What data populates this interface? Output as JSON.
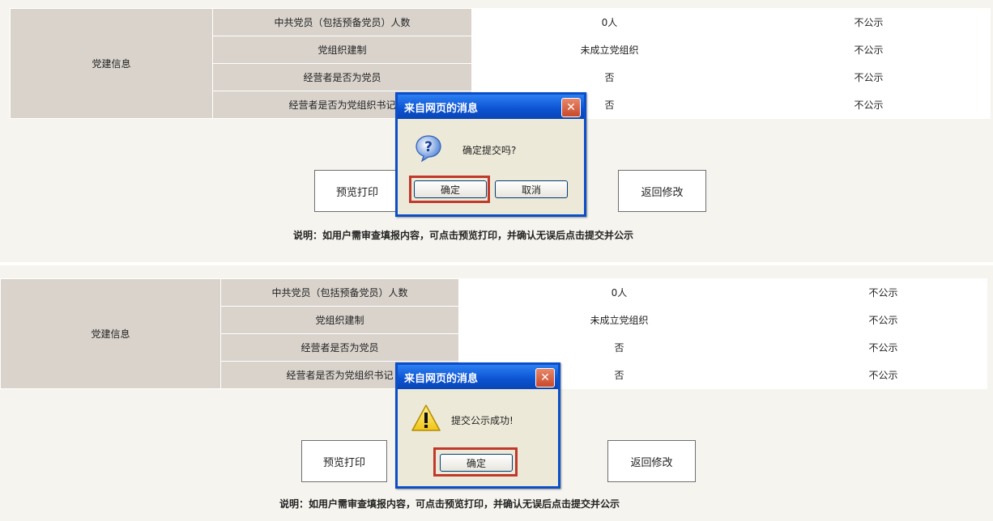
{
  "panel1": {
    "group_label": "党建信息",
    "rows": [
      {
        "label": "中共党员（包括预备党员）人数",
        "value": "0人",
        "public": "不公示"
      },
      {
        "label": "党组织建制",
        "value": "未成立党组织",
        "public": "不公示"
      },
      {
        "label": "经营者是否为党员",
        "value": "否",
        "public": "不公示"
      },
      {
        "label": "经营者是否为党组织书记",
        "value": "否",
        "public": "不公示"
      }
    ],
    "preview_label": "预览打印",
    "back_label": "返回修改",
    "note": "说明：如用户需审查填报内容，可点击预览打印，并确认无误后点击提交并公示",
    "dialog": {
      "title": "来自网页的消息",
      "icon": "question-icon",
      "message": "确定提交吗?",
      "ok_label": "确定",
      "cancel_label": "取消",
      "close_glyph": "✕"
    }
  },
  "panel2": {
    "group_label": "党建信息",
    "rows": [
      {
        "label": "中共党员（包括预备党员）人数",
        "value": "0人",
        "public": "不公示"
      },
      {
        "label": "党组织建制",
        "value": "未成立党组织",
        "public": "不公示"
      },
      {
        "label": "经营者是否为党员",
        "value": "否",
        "public": "不公示"
      },
      {
        "label": "经营者是否为党组织书记",
        "value": "否",
        "public": "不公示"
      }
    ],
    "preview_label": "预览打印",
    "back_label": "返回修改",
    "note": "说明：如用户需审查填报内容，可点击预览打印，并确认无误后点击提交并公示",
    "dialog": {
      "title": "来自网页的消息",
      "icon": "warning-icon",
      "message": "提交公示成功!",
      "ok_label": "确定",
      "close_glyph": "✕"
    }
  },
  "colors": {
    "accent_highlight": "#c0392b",
    "title_bar": "#0b52d1"
  }
}
